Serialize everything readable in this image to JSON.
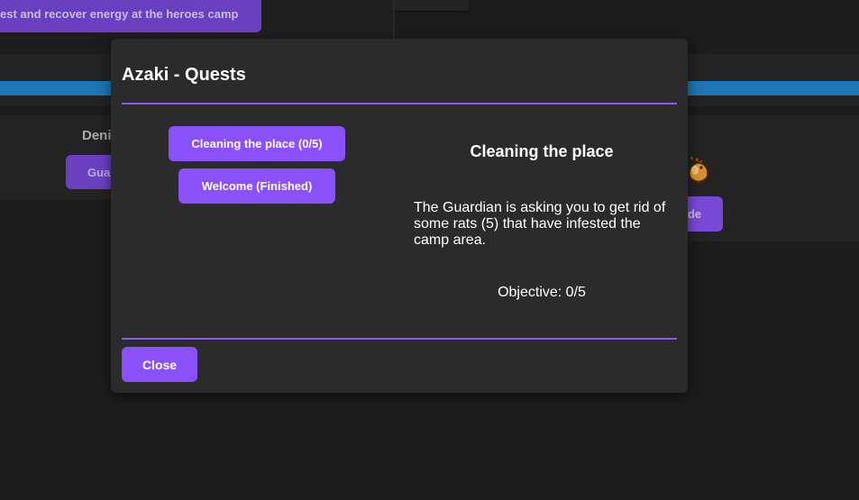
{
  "background": {
    "rest_button_label": "est and recover energy at the heroes camp",
    "left_card_name": "Deni",
    "left_card_button_label": "Gua",
    "right_card_button_label": "de"
  },
  "modal": {
    "title": "Azaki - Quests",
    "quests": [
      {
        "label": "Cleaning the place (0/5)"
      },
      {
        "label": "Welcome (Finished)"
      }
    ],
    "detail": {
      "title": "Cleaning the place",
      "description": "The Guardian is asking you to get rid of some rats (5) that have infested the camp area.",
      "objective": "Objective: 0/5"
    },
    "close_label": "Close"
  },
  "colors": {
    "accent": "#8a51fa",
    "progress_bar": "#1d76b5",
    "modal_bg": "#2b2b2c",
    "page_bg": "#1c1c1d"
  }
}
